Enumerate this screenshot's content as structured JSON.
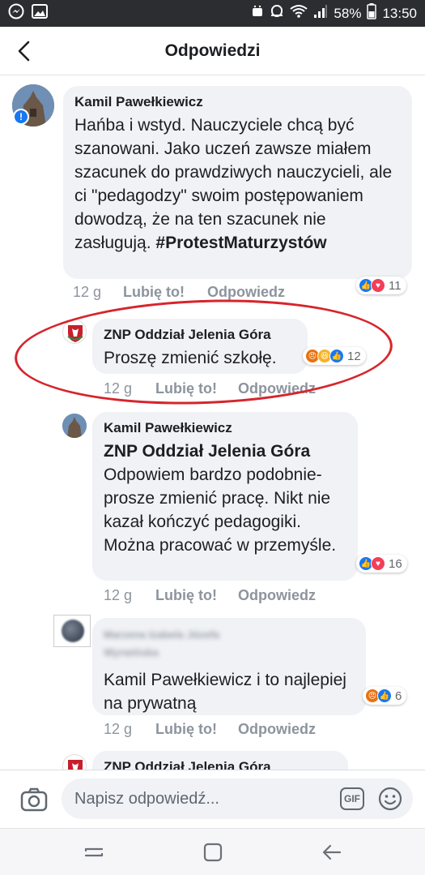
{
  "status_bar": {
    "battery": "58%",
    "time": "13:50"
  },
  "header": {
    "title": "Odpowiedzi"
  },
  "comments": [
    {
      "author": "Kamil Pawełkiewicz",
      "text": "Hańba i wstyd. Nauczyciele chcą być szanowani. Jako uczeń zawsze miałem szacunek do prawdziwych nauczycieli, ale ci \"pedagodzy\" swoim postępowaniem dowodzą, że na ten szacunek nie zasługują.",
      "hashtag": "#ProtestMaturzystów",
      "time": "12 g",
      "like": "Lubię to!",
      "reply": "Odpowiedz",
      "reactions_count": "11"
    },
    {
      "author": "ZNP Oddział Jelenia Góra",
      "text": "Proszę zmienić szkołę.",
      "time": "12 g",
      "like": "Lubię to!",
      "reply": "Odpowiedz",
      "reactions_count": "12"
    },
    {
      "author": "Kamil Pawełkiewicz",
      "mention": "ZNP Oddział Jelenia Góra",
      "text": "Odpowiem bardzo podobnie- prosze zmienić pracę.  Nikt nie kazał kończyć pedagogiki. Można pracować w przemyśle.",
      "time": "12 g",
      "like": "Lubię to!",
      "reply": "Odpowiedz",
      "reactions_count": "16"
    },
    {
      "author": "Marzena Izabela Józefa Wyrwińska",
      "text": "Kamil Pawełkiewicz i to najlepiej na prywatną",
      "time": "12 g",
      "like": "Lubię to!",
      "reply": "Odpowiedz",
      "reactions_count": "6"
    },
    {
      "author": "ZNP Oddział Jelenia Góra"
    }
  ],
  "composer": {
    "placeholder": "Napisz odpowiedź...",
    "gif_label": "GIF"
  },
  "colors": {
    "status_bar": "#2b2d31",
    "bubble": "#f0f2f5",
    "like_blue": "#1877f2",
    "love_red": "#f33e58",
    "annotation_red": "#d6252b"
  }
}
